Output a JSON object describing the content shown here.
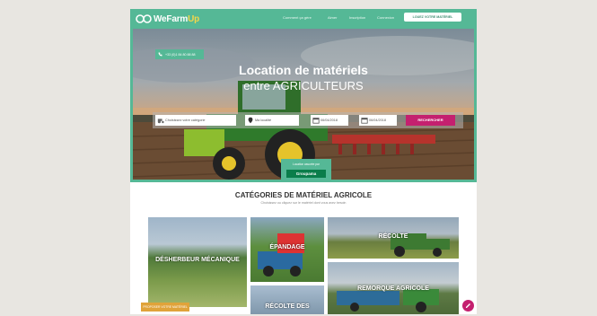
{
  "header": {
    "logo_prefix": "WeFarm",
    "logo_suffix": "Up",
    "nav": [
      "Comment ça gère",
      "Aimer",
      "Inscription",
      "Connexion"
    ],
    "cta_label": "LOUEZ VOTRE MATÉRIEL"
  },
  "hero": {
    "phone": "+33 (0)1 84 80 88 88",
    "title": "Location de matériels",
    "subtitle": "entre AGRICULTEURS"
  },
  "search": {
    "category_placeholder": "Choisissez votre catégorie",
    "location_placeholder": "Ma localité",
    "start_date": "06/04/2018",
    "end_date": "06/04/2018",
    "button_label": "RECHERCHER"
  },
  "partner": {
    "caption": "Location assurée par",
    "logo_text": "Groupama"
  },
  "categories": {
    "title": "CATÉGORIES DE MATÉRIEL AGRICOLE",
    "subtitle": "Choisissez ou cliquez sur le matériel dont vous avez besoin",
    "tiles": [
      "DÉSHERBEUR MÉCANIQUE",
      "ÉPANDAGE",
      "RÉCOLTE",
      "RÉCOLTE DES",
      "REMORQUE AGRICOLE"
    ]
  },
  "promo_label": "PROPOSER VOTRE MATÉRIEL",
  "colors": {
    "brand_green": "#55b896",
    "accent_magenta": "#c4206f",
    "logo_yellow": "#f3d64a"
  }
}
